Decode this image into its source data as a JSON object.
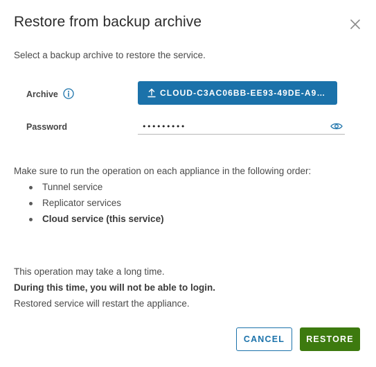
{
  "dialog": {
    "title": "Restore from backup archive",
    "intro": "Select a backup archive to restore the service."
  },
  "archive": {
    "label": "Archive",
    "button_label": "CLOUD-C3AC06BB-EE93-49DE-A9…",
    "button_icon": "upload-icon",
    "info_icon": "info-icon"
  },
  "password": {
    "label": "Password",
    "value": "•••••••••",
    "reveal_icon": "eye-icon"
  },
  "order": {
    "text": "Make sure to run the operation on each appliance in the following order:",
    "items": [
      "Tunnel service",
      "Replicator services",
      "Cloud service (this service)"
    ]
  },
  "notes": {
    "line1": "This operation may take a long time.",
    "line2": "During this time, you will not be able to login.",
    "line3": "Restored service will restart the appliance."
  },
  "actions": {
    "cancel_label": "CANCEL",
    "restore_label": "RESTORE"
  },
  "colors": {
    "primary_blue": "#1b72aa",
    "success_green": "#3d7a0f"
  }
}
